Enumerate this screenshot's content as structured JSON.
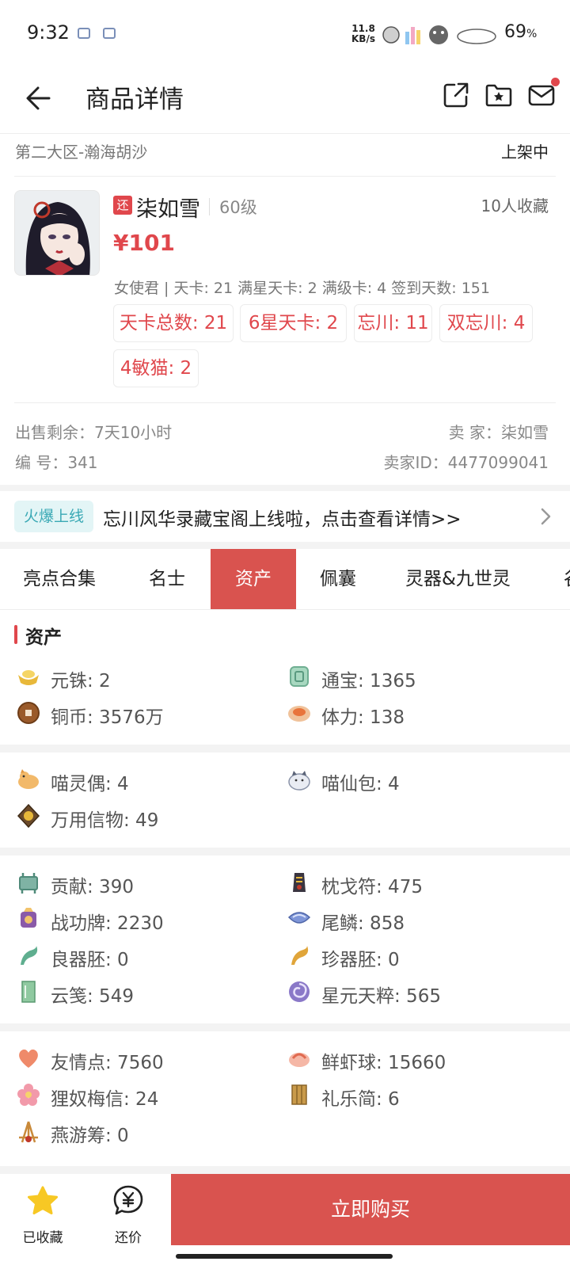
{
  "status_bar": {
    "time": "9:32",
    "net_speed_value": "11.8",
    "net_speed_unit": "KB/s",
    "battery": "69",
    "battery_unit": "%"
  },
  "nav": {
    "title": "商品详情",
    "icons": [
      "back-arrow-icon",
      "share-icon",
      "folder-star-icon",
      "mail-icon"
    ]
  },
  "listing": {
    "server": "第二大区-瀚海胡沙",
    "status": "上架中"
  },
  "product": {
    "tag": "还",
    "name": "柒如雪",
    "level": "60级",
    "favorites": "10人收藏",
    "price": "¥101",
    "description": "女使君 | 天卡: 21 满星天卡: 2 满级卡: 4 签到天数: 151",
    "chips": [
      "天卡总数: 21",
      "6星天卡: 2",
      "忘川: 11",
      "双忘川: 4",
      "4敏猫: 2"
    ]
  },
  "meta": {
    "time_left": "出售剩余：7天10小时",
    "seller": "卖  家：柒如雪",
    "serial": "编  号：341",
    "seller_id": "卖家ID：4477099041"
  },
  "banner": {
    "tag": "火爆上线",
    "text": "忘川风华录藏宝阁上线啦，点击查看详情>>"
  },
  "tabs": [
    "亮点合集",
    "名士",
    "资产",
    "佩囊",
    "灵器&九世灵",
    "谷"
  ],
  "active_tab": "资产",
  "assets": {
    "title": "资产",
    "groups": [
      [
        {
          "label": "元铢: 2",
          "icon": "gold-ingot-icon"
        },
        {
          "label": "通宝: 1365",
          "icon": "jade-token-icon"
        },
        {
          "label": "铜币: 3576万",
          "icon": "copper-coin-icon"
        },
        {
          "label": "体力: 138",
          "icon": "stamina-bun-icon"
        }
      ],
      [
        {
          "label": "喵灵偶: 4",
          "icon": "cat-doll-icon"
        },
        {
          "label": "喵仙包: 4",
          "icon": "cat-bun-icon"
        },
        {
          "label": "万用信物: 49",
          "icon": "token-icon"
        }
      ],
      [
        {
          "label": "贡献: 390",
          "icon": "cauldron-icon"
        },
        {
          "label": "枕戈符: 475",
          "icon": "talisman-icon"
        },
        {
          "label": "战功牌: 2230",
          "icon": "war-medal-icon"
        },
        {
          "label": "尾鳞: 858",
          "icon": "scale-icon"
        },
        {
          "label": "良器胚: 0",
          "icon": "green-ore-icon"
        },
        {
          "label": "珍器胚: 0",
          "icon": "gold-ore-icon"
        },
        {
          "label": "云笺: 549",
          "icon": "cloud-paper-icon"
        },
        {
          "label": "星元天粹: 565",
          "icon": "star-swirl-icon"
        }
      ],
      [
        {
          "label": "友情点: 7560",
          "icon": "heart-icon"
        },
        {
          "label": "鲜虾球: 15660",
          "icon": "shrimp-ball-icon"
        },
        {
          "label": "狸奴梅信: 24",
          "icon": "plum-blossom-icon"
        },
        {
          "label": "礼乐简: 6",
          "icon": "bamboo-slip-icon"
        },
        {
          "label": "燕游筹: 0",
          "icon": "tally-sticks-icon"
        }
      ]
    ]
  },
  "bottom": {
    "favorited": "已收藏",
    "bargain": "还价",
    "buy": "立即购买"
  },
  "colors": {
    "accent": "#e0474c",
    "buy_button": "#d9534f",
    "banner_tag_bg": "#e3f5f6",
    "banner_tag_text": "#3aa9b5"
  }
}
